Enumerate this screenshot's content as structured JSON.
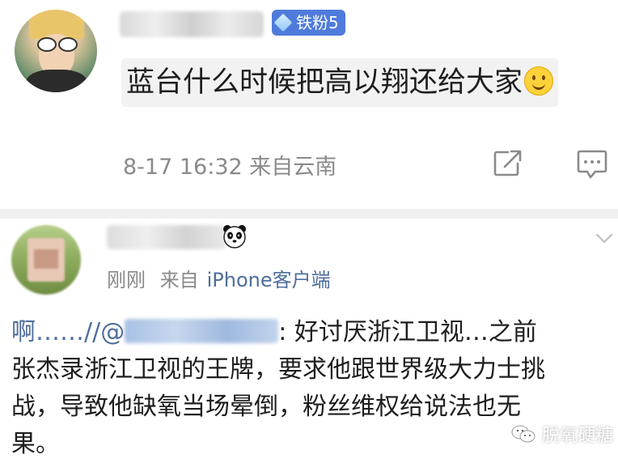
{
  "post1": {
    "badge_label": "铁粉5",
    "content_text": "蓝台什么时候把高以翔还给大家",
    "emoji_icon": "smile-emoji-icon",
    "timestamp": "8-17 16:32",
    "source": "来自云南",
    "actions": [
      "share-icon",
      "comment-icon"
    ]
  },
  "post2": {
    "name_icon": "panda-icon",
    "time": "刚刚",
    "source_prefix": "来自",
    "source_app": "iPhone客户端",
    "lines": {
      "l1_prefix": "啊……//@",
      "l1_suffix": ": 好讨厌浙江卫视…之前",
      "l2": "张杰录浙江卫视的王牌，要求他跟世界级大力士挑",
      "l3": "战，导致他缺氧当场晕倒，粉丝维权给说法也无",
      "l4": "果。"
    }
  },
  "watermark": {
    "text": "脱氧硬糖"
  },
  "colors": {
    "badge_blue": "#4f7bdc",
    "link_blue": "#4f6e9c",
    "meta_gray": "#8a8a8a",
    "divider_gray": "#f0f0f0"
  }
}
